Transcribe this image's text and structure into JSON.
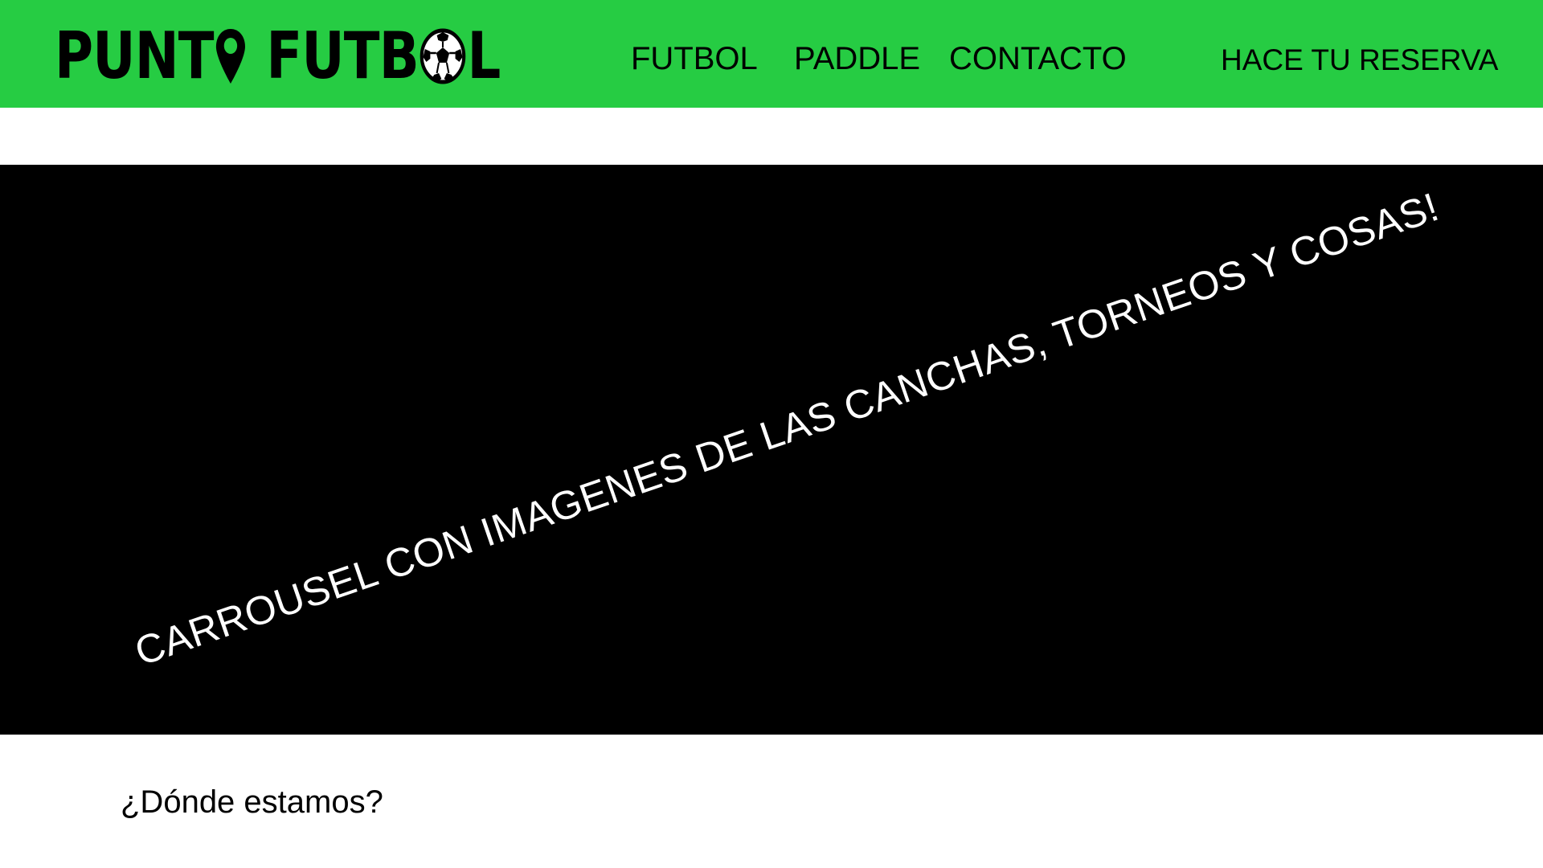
{
  "header": {
    "logo": {
      "text_left": "PUNT",
      "text_right_a": "FUTB",
      "text_right_b": "L",
      "pin_icon": "map-pin-icon",
      "ball_icon": "soccer-ball-icon"
    },
    "nav": {
      "futbol": "FUTBOL",
      "paddle": "PADDLE",
      "contacto": "CONTACTO",
      "reserva": "HACE TU RESERVA"
    },
    "background_color": "#26cc43"
  },
  "carousel": {
    "text": "CARROUSEL CON IMAGENES DE LAS CANCHAS, TORNEOS Y COSAS!",
    "background_color": "#000000"
  },
  "location": {
    "title": "¿Dónde estamos?"
  }
}
